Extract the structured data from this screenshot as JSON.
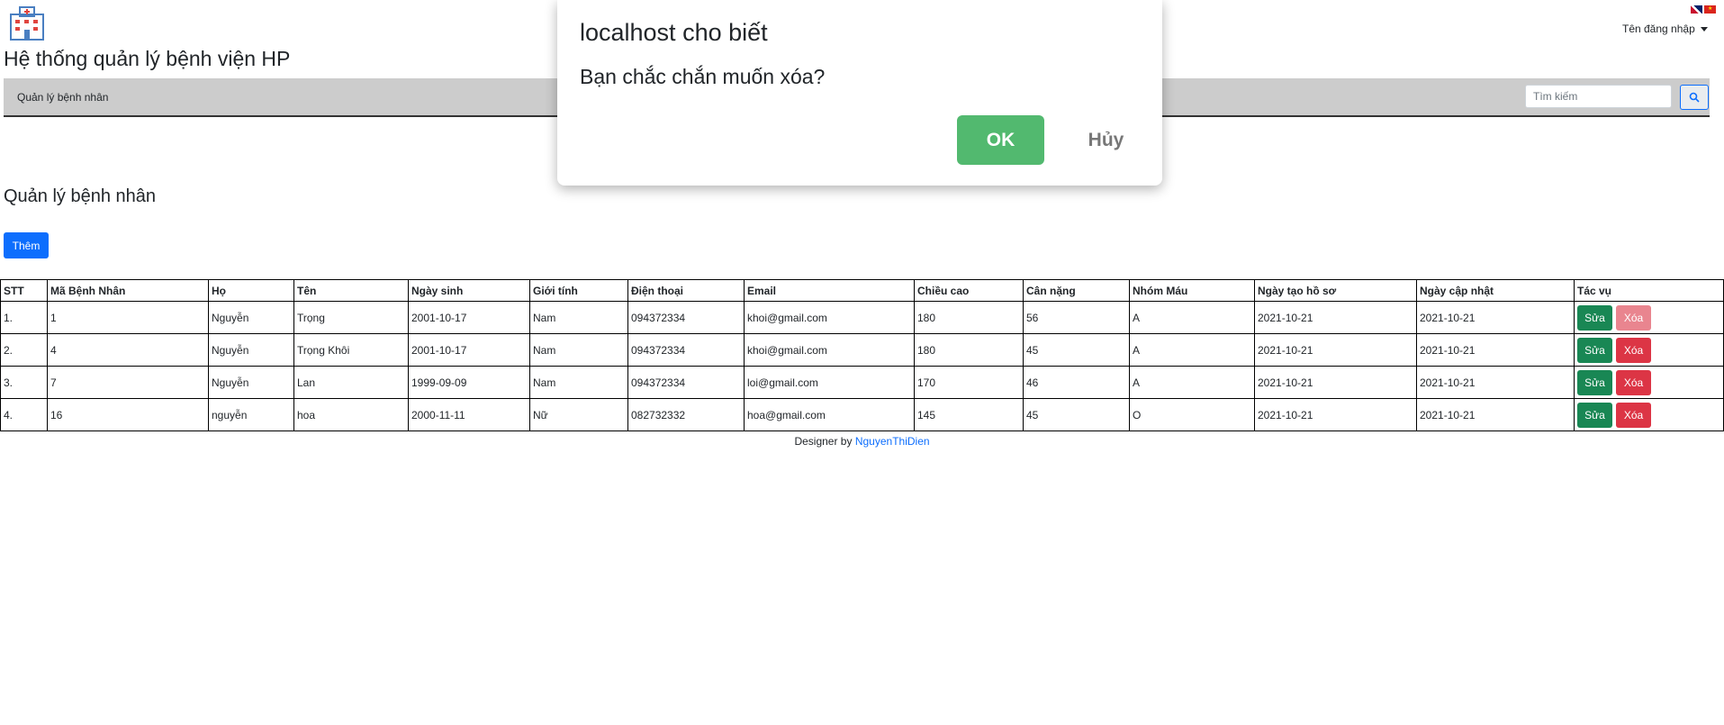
{
  "header": {
    "logo_icon": "hospital-icon",
    "site_title": "Hệ thống quản lý bệnh viện HP",
    "user_menu_label": "Tên đăng nhập",
    "flags": [
      "uk-flag-icon",
      "vn-flag-icon"
    ]
  },
  "navbar": {
    "items": [
      {
        "label": "Quản lý bệnh nhân"
      }
    ],
    "search": {
      "placeholder": "Tìm kiếm",
      "value": ""
    },
    "search_icon": "search-icon"
  },
  "main": {
    "heading": "Quản lý bệnh nhân",
    "add_button_label": "Thêm"
  },
  "table": {
    "columns": [
      "STT",
      "Mã Bệnh Nhân",
      "Họ",
      "Tên",
      "Ngày sinh",
      "Giới tính",
      "Điện thoại",
      "Email",
      "Chiều cao",
      "Cân nặng",
      "Nhóm Máu",
      "Ngày tạo hồ sơ",
      "Ngày cập nhật",
      "Tác vụ"
    ],
    "edit_label": "Sửa",
    "delete_label": "Xóa",
    "rows": [
      {
        "stt": "1.",
        "ma": "1",
        "ho": "Nguyễn",
        "ten": "Trọng",
        "ngay_sinh": "2001-10-17",
        "gioi_tinh": "Nam",
        "dien_thoai": "094372334",
        "email": "khoi@gmail.com",
        "chieu_cao": "180",
        "can_nang": "56",
        "nhom_mau": "A",
        "ngay_tao": "2021-10-21",
        "ngay_cap_nhat": "2021-10-21"
      },
      {
        "stt": "2.",
        "ma": "4",
        "ho": "Nguyễn",
        "ten": "Trọng Khôi",
        "ngay_sinh": "2001-10-17",
        "gioi_tinh": "Nam",
        "dien_thoai": "094372334",
        "email": "khoi@gmail.com",
        "chieu_cao": "180",
        "can_nang": "45",
        "nhom_mau": "A",
        "ngay_tao": "2021-10-21",
        "ngay_cap_nhat": "2021-10-21"
      },
      {
        "stt": "3.",
        "ma": "7",
        "ho": "Nguyễn",
        "ten": "Lan",
        "ngay_sinh": "1999-09-09",
        "gioi_tinh": "Nam",
        "dien_thoai": "094372334",
        "email": "loi@gmail.com",
        "chieu_cao": "170",
        "can_nang": "46",
        "nhom_mau": "A",
        "ngay_tao": "2021-10-21",
        "ngay_cap_nhat": "2021-10-21"
      },
      {
        "stt": "4.",
        "ma": "16",
        "ho": "nguyễn",
        "ten": "hoa",
        "ngay_sinh": "2000-11-11",
        "gioi_tinh": "Nữ",
        "dien_thoai": "082732332",
        "email": "hoa@gmail.com",
        "chieu_cao": "145",
        "can_nang": "45",
        "nhom_mau": "O",
        "ngay_tao": "2021-10-21",
        "ngay_cap_nhat": "2021-10-21"
      }
    ]
  },
  "footer": {
    "prefix": "Designer by",
    "link_text": "NguyenThiDien"
  },
  "dialog": {
    "title": "localhost cho biết",
    "message": "Bạn chắc chắn muốn xóa?",
    "ok_label": "OK",
    "cancel_label": "Hủy"
  },
  "colors": {
    "primary": "#0d6efd",
    "success": "#198754",
    "danger": "#dc3545",
    "navbar_bg": "#cccccc",
    "dialog_ok": "#52b96f"
  }
}
